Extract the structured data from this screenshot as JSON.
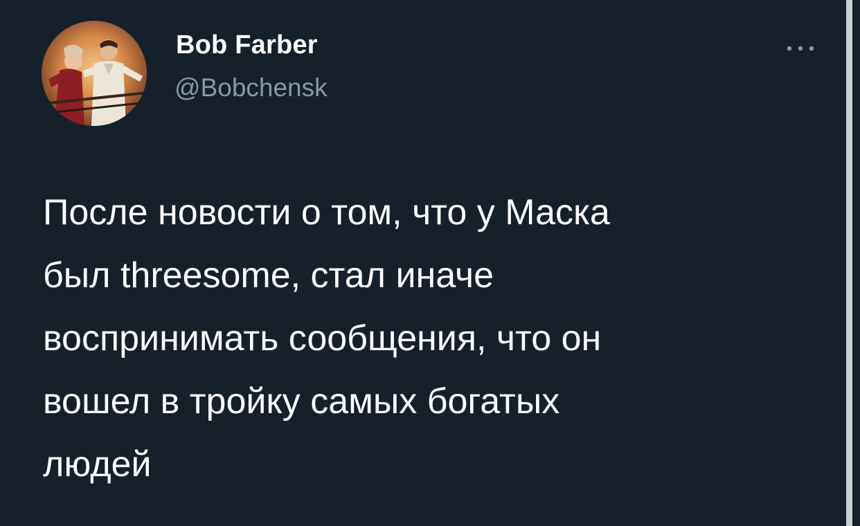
{
  "tweet": {
    "display_name": "Bob Farber",
    "handle": "@Bobchensk",
    "text_lines": [
      "После новости о том, что у Маска",
      "был threesome, стал иначе",
      "воспринимать сообщения, что он",
      "вошел в тройку самых богатых",
      "людей"
    ]
  },
  "icons": {
    "more": "more-horizontal-icon"
  },
  "colors": {
    "background": "#15202b",
    "text_primary": "#ffffff",
    "text_secondary": "#8899a6"
  }
}
